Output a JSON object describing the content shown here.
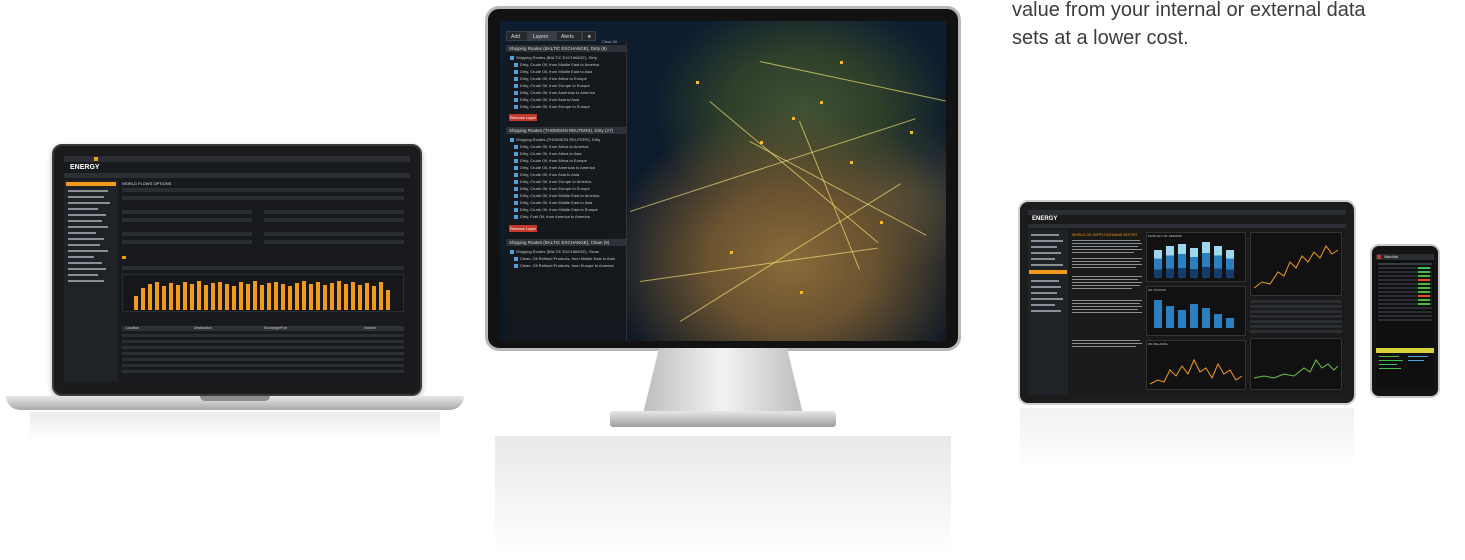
{
  "intro": {
    "lines": [
      "value from your internal or external data",
      "sets at a lower cost."
    ]
  },
  "laptop": {
    "app_title": "ENERGY",
    "panel_title": "WORLD FLOWS OPTIONS",
    "table_header": [
      "Location",
      "Destination",
      "Exchange/Port",
      "Volume"
    ]
  },
  "monitor": {
    "tabs": [
      "Add",
      "Layers",
      "Alerts",
      "★"
    ],
    "clear_all": "Clear All",
    "groups": [
      {
        "title": "Shipping Routes (BALTIC EXCHANGE), Dirty (9)",
        "items": [
          "Shipping Routes (BALTIC EXCHANGE), Dirty",
          "Dirty, Crude Oil, from Middle East to America",
          "Dirty, Crude Oil, from Middle East to Asia",
          "Dirty, Crude Oil, from Africa to Europe",
          "Dirty, Crude Oil, from Europe to Europe",
          "Dirty, Crude Oil, from Americas to America",
          "Dirty, Crude Oil, from Asia to Asia",
          "Dirty, Crude Oil, from Europe to Europe"
        ],
        "remove": "Remove Layer"
      },
      {
        "title": "Shipping Routes (THOMSON REUTERS), Dirty (27)",
        "items": [
          "Shipping Routes (THOMSON REUTERS), Dirty",
          "Dirty, Crude Oil, from Africa to America",
          "Dirty, Crude Oil, from Africa to Asia",
          "Dirty, Crude Oil, from Africa to Europe",
          "Dirty, Crude Oil, from Americas to America",
          "Dirty, Crude Oil, from Asia to Asia",
          "Dirty, Crude Oil, from Europe to America",
          "Dirty, Crude Oil, from Europe to Europe",
          "Dirty, Crude Oil, from Middle East to America",
          "Dirty, Crude Oil, from Middle East to Asia",
          "Dirty, Crude Oil, from Middle East to Europe",
          "Dirty, Fuel Oil, from America to America"
        ],
        "remove": "Remove Layer"
      },
      {
        "title": "Shipping Routes (BALTIC EXCHANGE), Clean (9)",
        "items": [
          "Shipping Routes (BALTIC EXCHANGE), Clean",
          "Clean, Oil Refined Products, from Middle East to Asia",
          "Clean, Oil Refined Products, from Europe to America"
        ]
      }
    ]
  },
  "tablet": {
    "app_title": "ENERGY",
    "article_title": "WORLD OIL SUPPLY/DEMAND REPORT",
    "panel_titles": [
      "MONTHLY OIL DEMAND",
      "OIL STOCKS",
      "OIL BALANCE"
    ]
  },
  "phone": {
    "app_title": "Watchlist"
  },
  "colors": {
    "accent": "#f39a1d",
    "map_route": "#f5e37a",
    "remove_button": "#c0392b"
  }
}
